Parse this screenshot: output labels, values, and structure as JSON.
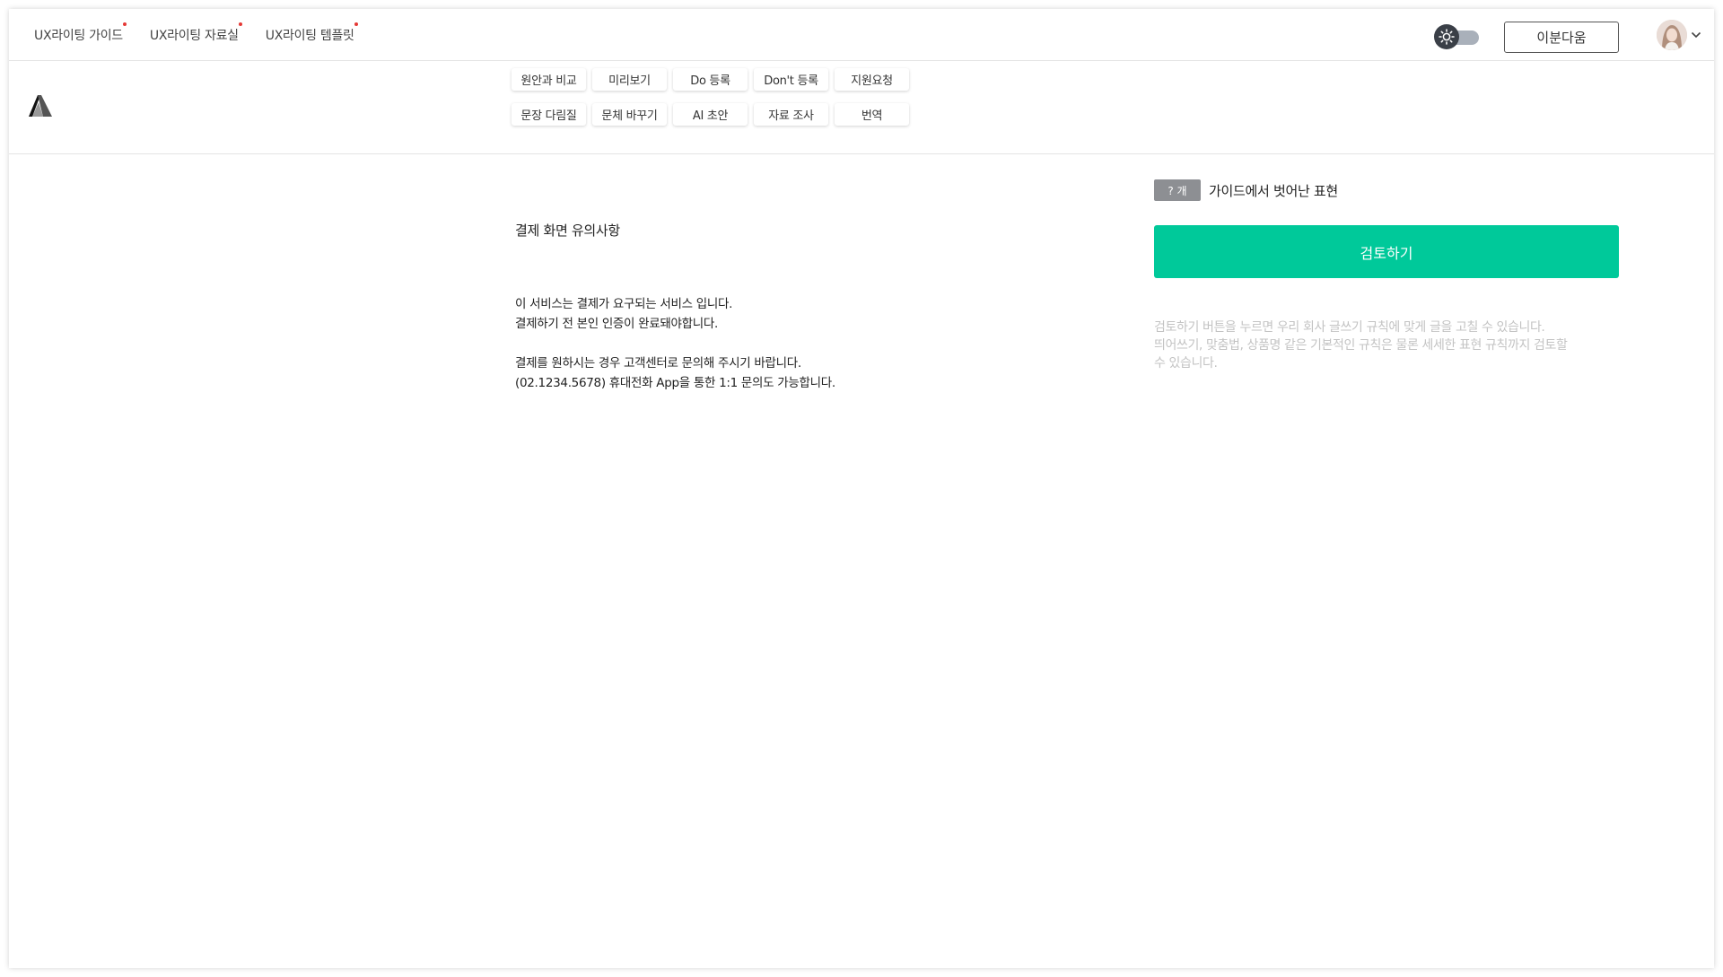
{
  "topnav": {
    "items": [
      {
        "label": "UX라이팅 가이드",
        "has_dot": true
      },
      {
        "label": "UX라이팅 자료실",
        "has_dot": true
      },
      {
        "label": "UX라이팅 템플릿",
        "has_dot": true
      }
    ],
    "theme_toggle": {
      "icon": "sun-icon",
      "state": "light"
    },
    "user_name": "이분다움",
    "avatar_icon": "user-avatar",
    "dropdown_icon": "chevron-down-icon"
  },
  "toolbar": {
    "logo_icon": "app-logo",
    "buttons": [
      "원안과 비교",
      "미리보기",
      "Do 등록",
      "Don't 등록",
      "지원요청",
      "문장 다림질",
      "문체 바꾸기",
      "AI 초안",
      "자료 조사",
      "번역"
    ]
  },
  "document": {
    "title": "결제 화면 유의사항",
    "lines": [
      "이 서비스는 결제가 요구되는 서비스 입니다.",
      "결제하기 전 본인 인증이 완료돼야합니다.",
      "",
      "결제를 원하시는 경우 고객센터로 문의해 주시기 바랍니다.",
      "(02.1234.5678) 휴대전화 App을 통한 1:1 문의도 가능합니다."
    ]
  },
  "review_panel": {
    "count_badge": "? 개",
    "count_label": "가이드에서 벗어난 표현",
    "review_button": "검토하기",
    "hint_lines": [
      "검토하기 버튼을 누르면 우리 회사 글쓰기 규칙에 맞게 글을 고칠 수 있습니다.",
      "띄어쓰기, 맞춤법, 상품명 같은 기본적인 규칙은 물론 세세한 표현 규칙까지 검토할",
      "수 있습니다."
    ],
    "accent_color": "#00c99a"
  }
}
